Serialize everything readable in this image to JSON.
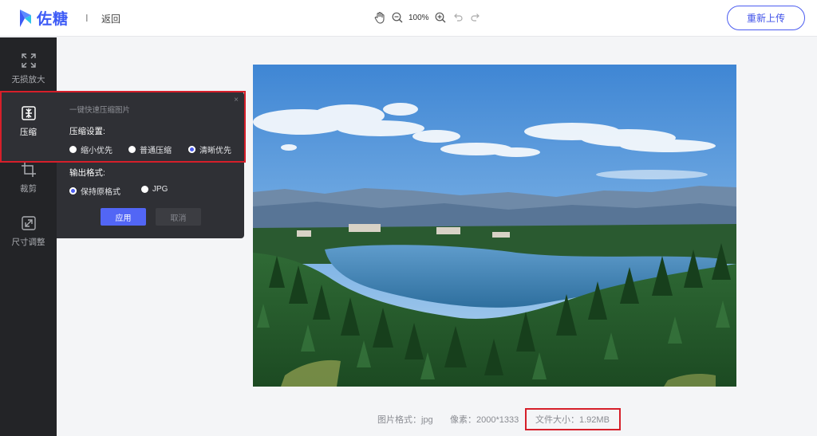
{
  "header": {
    "app_name": "佐糖",
    "separator": "I",
    "back_label": "返回",
    "zoom_level": "100%",
    "reupload_label": "重新上传",
    "accent_color": "#4b5cf0"
  },
  "sidebar": {
    "items": [
      {
        "label": "无损放大",
        "icon": "expand-icon"
      },
      {
        "label": "压缩",
        "icon": "compress-icon",
        "active": true
      },
      {
        "label": "裁剪",
        "icon": "crop-icon"
      },
      {
        "label": "尺寸调整",
        "icon": "resize-icon"
      }
    ]
  },
  "panel": {
    "hint": "一键快速压缩图片",
    "close": "×",
    "compress_settings_label": "压缩设置:",
    "compress_options": [
      {
        "label": "缩小优先",
        "selected": false
      },
      {
        "label": "普通压缩",
        "selected": false
      },
      {
        "label": "清晰优先",
        "selected": true
      }
    ],
    "output_format_label": "输出格式:",
    "format_options": [
      {
        "label": "保持原格式",
        "selected": true
      },
      {
        "label": "JPG",
        "selected": false
      }
    ],
    "apply_label": "应用",
    "cancel_label": "取消"
  },
  "image_info": {
    "format": "图片格式：jpg",
    "pixels": "像素：2000*1333",
    "file_size": "文件大小：1.92MB"
  },
  "highlight_color": "#d61f2a"
}
